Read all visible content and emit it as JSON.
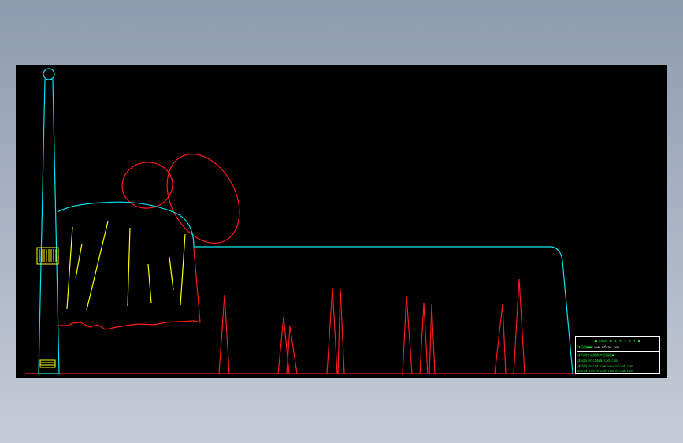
{
  "colors": {
    "window_background": "#000000",
    "bed_outline": "#00e5ee",
    "canopy_folds": "#ffff00",
    "red_linework": "#ff1a1a",
    "titleblock_text": "#22e83a",
    "titleblock_border": "#ffffff"
  },
  "titleblock": {
    "row1": "■ 沐风 H i t t e r ■",
    "row2_left": "沐风网■■■",
    "row2_right": "www.mfcad.com",
    "row3": "沐风网专业提供产品图纸■",
    "row4": "沐风网 mfcad@mfcad.com",
    "row5": "沐风网 mfcad.com www.mfcad.com",
    "row6": "mfcad.com mfcad.com mfcad.com"
  }
}
